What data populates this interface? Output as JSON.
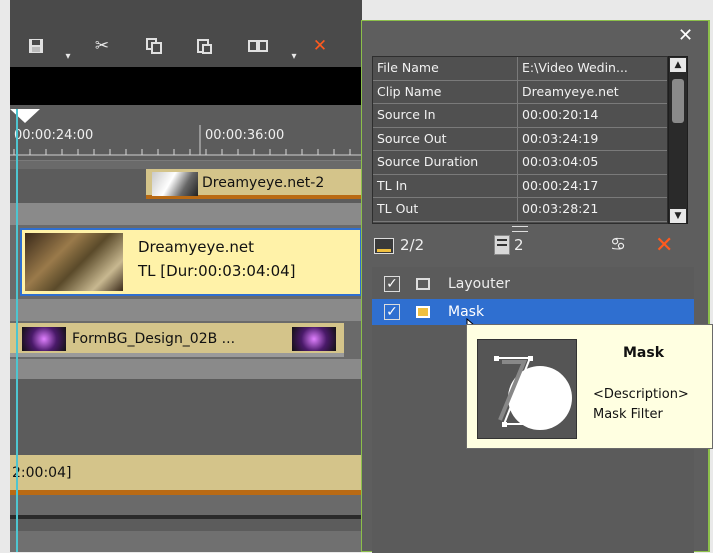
{
  "timeline": {
    "ruler_ticks": [
      "00:00:24:00",
      "00:00:36:00"
    ],
    "clips": {
      "clip1_label": "Dreamyeye.net-2",
      "clip2_title": "Dreamyeye.net",
      "clip2_duration": "TL [Dur:00:03:04:04]",
      "clip3_label": "FormBG_Design_02B  ...",
      "clip4_label": "2:00:04]"
    }
  },
  "panel": {
    "close_icon": "close-icon",
    "properties": [
      {
        "key": "File Name",
        "value": "E:\\Video Wedin..."
      },
      {
        "key": "Clip Name",
        "value": "Dreamyeye.net"
      },
      {
        "key": "Source In",
        "value": "00:00:20:14"
      },
      {
        "key": "Source Out",
        "value": "00:03:24:19"
      },
      {
        "key": "Source Duration",
        "value": "00:03:04:05"
      },
      {
        "key": "TL In",
        "value": "00:00:24:17"
      },
      {
        "key": "TL Out",
        "value": "00:03:28:21"
      }
    ],
    "count_label": "2/2",
    "filter_count": "2",
    "filters": [
      {
        "name": "Layouter",
        "checked": true
      },
      {
        "name": "Mask",
        "checked": true
      }
    ]
  },
  "tooltip": {
    "title": "Mask",
    "desc_line1": "<Description>",
    "desc_line2": "Mask Filter"
  },
  "colors": {
    "accent_orange": "#ff5a1e",
    "selection_blue": "#2f6fd0",
    "clip_yellow": "#fff2a8",
    "clip_tan": "#d4c48a"
  }
}
